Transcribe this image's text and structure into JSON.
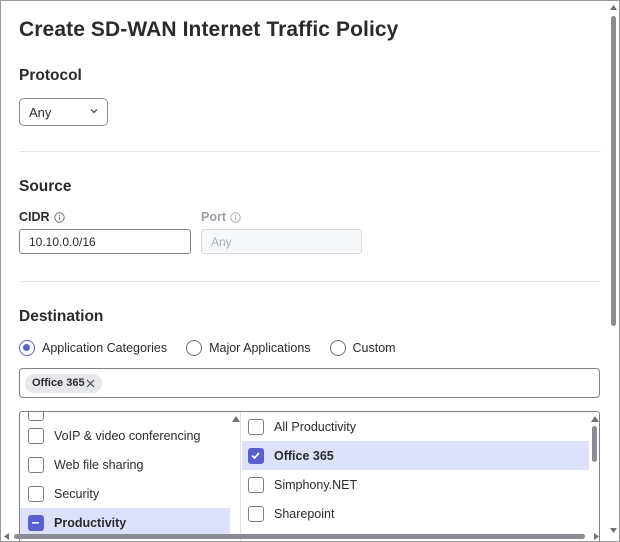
{
  "page": {
    "title": "Create SD-WAN Internet Traffic Policy"
  },
  "protocol": {
    "section_title": "Protocol",
    "selected": "Any"
  },
  "source": {
    "section_title": "Source",
    "cidr_label": "CIDR",
    "cidr_value": "10.10.0.0/16",
    "port_label": "Port",
    "port_placeholder": "Any"
  },
  "destination": {
    "section_title": "Destination",
    "radio_options": [
      {
        "label": "Application Categories",
        "checked": true
      },
      {
        "label": "Major Applications",
        "checked": false
      },
      {
        "label": "Custom",
        "checked": false
      }
    ],
    "selected_tags": [
      {
        "label": "Office 365"
      }
    ],
    "categories": [
      {
        "label": "VoIP & video conferencing",
        "state": "unchecked"
      },
      {
        "label": "Web file sharing",
        "state": "unchecked"
      },
      {
        "label": "Security",
        "state": "unchecked"
      },
      {
        "label": "Productivity",
        "state": "mixed",
        "selected": true
      }
    ],
    "applications": [
      {
        "label": "All Productivity",
        "state": "unchecked"
      },
      {
        "label": "Office 365",
        "state": "checked",
        "selected": true
      },
      {
        "label": "Simphony.NET",
        "state": "unchecked"
      },
      {
        "label": "Sharepoint",
        "state": "unchecked"
      }
    ]
  },
  "colors": {
    "accent": "#5a5fcf",
    "selected_row": "#dde1fb",
    "tag_bg": "#e6e8ec"
  }
}
